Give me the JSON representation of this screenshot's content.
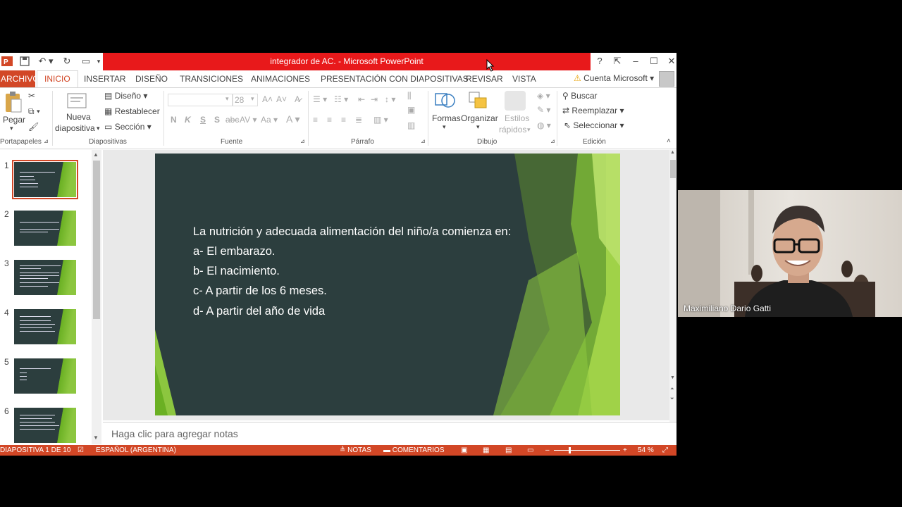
{
  "window": {
    "title": "integrador de AC. - Microsoft PowerPoint"
  },
  "tabs": [
    "ARCHIVO",
    "INICIO",
    "INSERTAR",
    "DISEÑO",
    "TRANSICIONES",
    "ANIMACIONES",
    "PRESENTACIÓN CON DIAPOSITIVAS",
    "REVISAR",
    "VISTA"
  ],
  "account": "Cuenta Microsoft",
  "ribbon": {
    "portapapeles": {
      "pegar": "Pegar",
      "label": "Portapapeles"
    },
    "diapositivas": {
      "nueva1": "Nueva",
      "nueva2": "diapositiva",
      "diseno": "Diseño",
      "restablecer": "Restablecer",
      "seccion": "Sección",
      "label": "Diapositivas"
    },
    "fuente": {
      "size": "28",
      "label": "Fuente"
    },
    "parrafo": {
      "label": "Párrafo"
    },
    "dibujo": {
      "formas": "Formas",
      "organizar": "Organizar",
      "estilos1": "Estilos",
      "estilos2": "rápidos",
      "label": "Dibujo"
    },
    "edicion": {
      "buscar": "Buscar",
      "reemplazar": "Reemplazar",
      "seleccionar": "Seleccionar",
      "label": "Edición"
    }
  },
  "thumbnails": [
    "1",
    "2",
    "3",
    "4",
    "5",
    "6"
  ],
  "slide": {
    "lines": [
      "La nutrición y adecuada alimentación del niño/a comienza en:",
      "a- El embarazo.",
      "b- El nacimiento.",
      "c- A partir de los 6 meses.",
      "d- A partir del año de vida"
    ]
  },
  "notes_placeholder": "Haga clic para agregar notas",
  "status": {
    "slide": "DIAPOSITIVA 1 DE 10",
    "language": "ESPAÑOL (ARGENTINA)",
    "notes": "NOTAS",
    "comments": "COMENTARIOS",
    "zoom": "54 %"
  },
  "participant": {
    "name": "Maximiliano Dario Gatti"
  },
  "colors": {
    "accent": "#d24726",
    "titlebar": "#e8191b",
    "slide_bg": "#2c3e3e",
    "slide_green": "#8cc63f"
  }
}
